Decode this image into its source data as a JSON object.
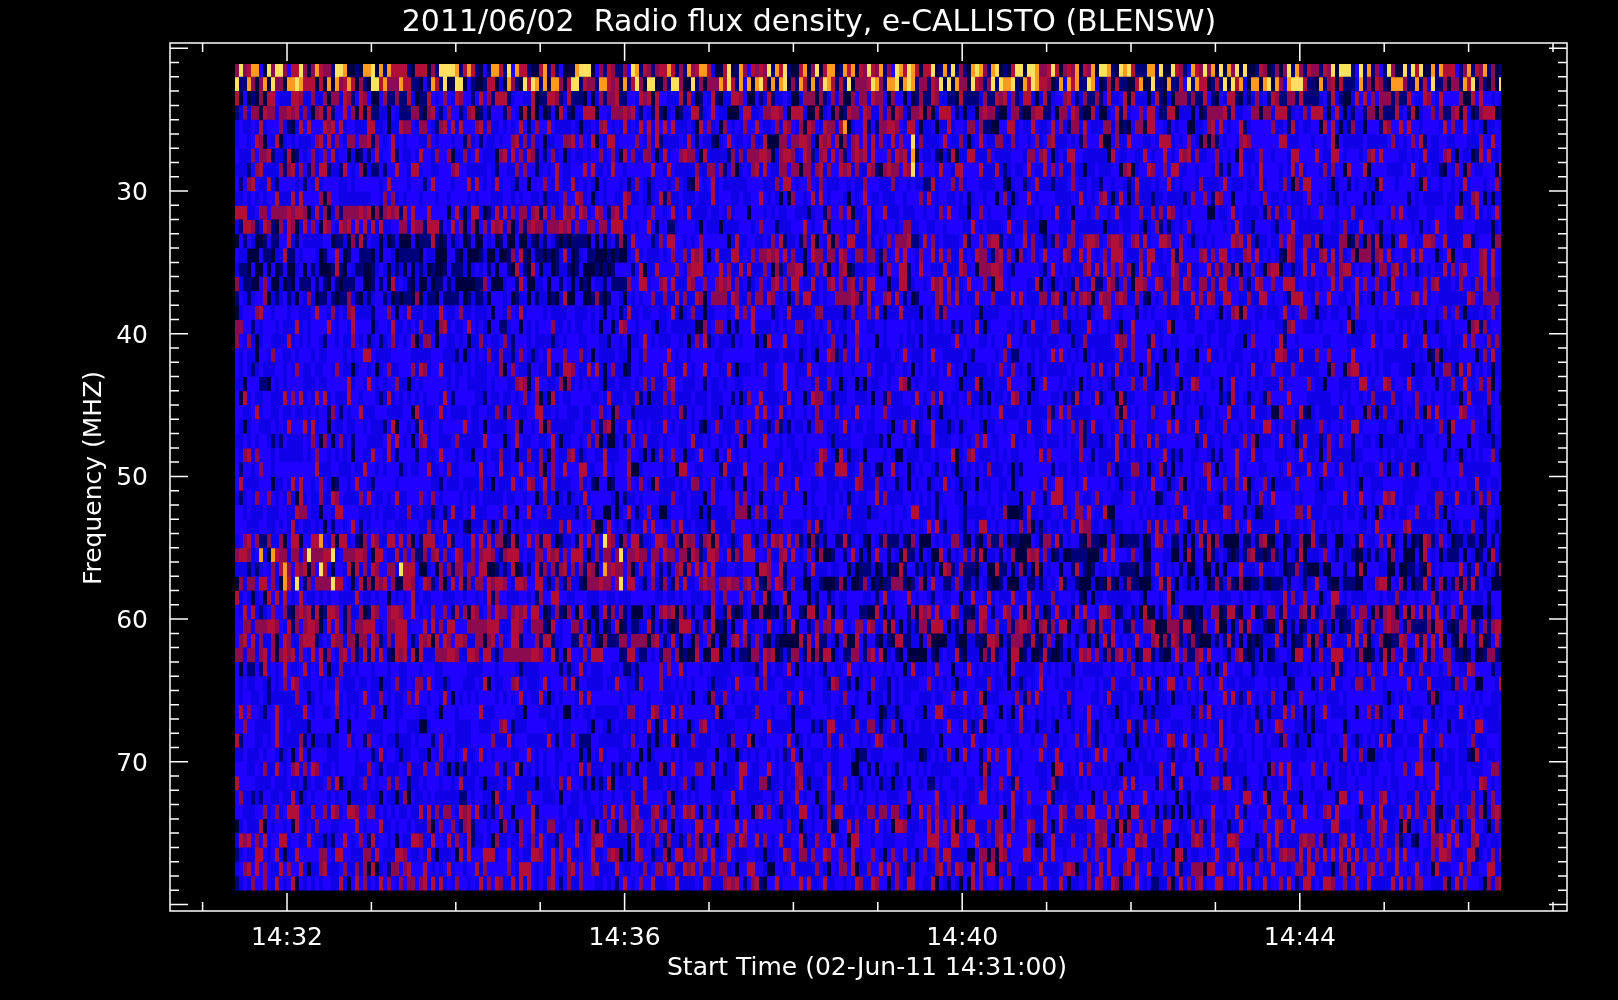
{
  "title": "2011/06/02  Radio flux density, e-CALLISTO (BLENSW)",
  "y_axis": {
    "label": "Frequency (MHZ)",
    "ticks": [
      "30",
      "40",
      "50",
      "60",
      "70"
    ]
  },
  "x_axis": {
    "label": "Start Time (02-Jun-11 14:31:00)",
    "ticks": [
      "14:32",
      "14:36",
      "14:40",
      "14:44"
    ]
  }
}
